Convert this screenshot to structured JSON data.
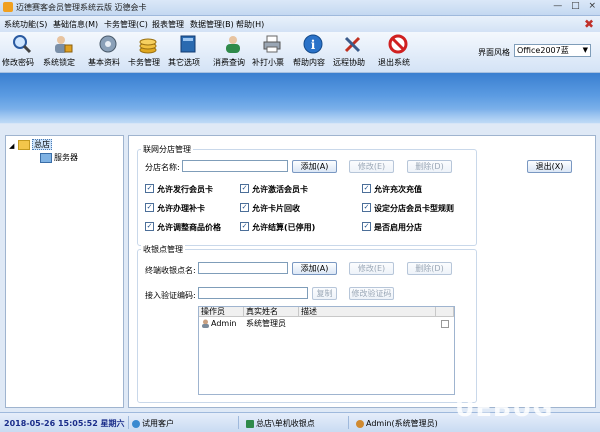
{
  "window": {
    "title": "迈德赛客会员管理系统云版  迈德会卡",
    "controls": [
      "—",
      "□",
      "×"
    ]
  },
  "menu": {
    "items": [
      "系统功能(S)",
      "基础信息(M)",
      "卡务管理(C)",
      "报表管理",
      "数据管理(B)",
      "帮助(H)"
    ],
    "close_glyph": "✖"
  },
  "toolbar": {
    "buttons": [
      {
        "label": "修改密码",
        "icon": "magnifier-icon"
      },
      {
        "label": "系统锁定",
        "icon": "lock-user-icon"
      },
      {
        "label": "基本资料",
        "icon": "gear-icon"
      },
      {
        "label": "卡务管理",
        "icon": "coins-icon"
      },
      {
        "label": "其它选项",
        "icon": "book-icon"
      },
      {
        "label": "消费查询",
        "icon": "user-icon"
      },
      {
        "label": "补打小票",
        "icon": "printer-icon"
      },
      {
        "label": "帮助内容",
        "icon": "info-icon"
      },
      {
        "label": "远程协助",
        "icon": "tools-icon"
      },
      {
        "label": "退出系统",
        "icon": "stop-icon"
      }
    ],
    "theme_label": "界面风格",
    "theme_value": "Office2007蓝"
  },
  "tree": {
    "root": "总店",
    "child": "服务器"
  },
  "branch": {
    "group_title": "联网分店管理",
    "name_label": "分店名称:",
    "name_value": "",
    "add": "添加(A)",
    "edit": "修改(E)",
    "delete": "删除(D)",
    "exit": "退出(X)",
    "options": [
      {
        "label": "允许发行会员卡",
        "checked": true
      },
      {
        "label": "允许激活会员卡",
        "checked": true
      },
      {
        "label": "允许充次充值",
        "checked": true
      },
      {
        "label": "允许办理补卡",
        "checked": true
      },
      {
        "label": "允许卡片回收",
        "checked": true
      },
      {
        "label": "设定分店会员卡型规则",
        "checked": true
      },
      {
        "label": "允许调整商品价格",
        "checked": true
      },
      {
        "label": "允许结算(已停用)",
        "checked": true
      },
      {
        "label": "是否启用分店",
        "checked": true
      }
    ]
  },
  "terminal": {
    "group_title": "收银点管理",
    "name_label": "终端收银点名:",
    "name_value": "",
    "add": "添加(A)",
    "edit": "修改(E)",
    "delete": "删除(D)",
    "code_label": "接入验证编码:",
    "code_value": "",
    "copy": "复制",
    "change_code": "修改验证码",
    "columns": [
      "操作员",
      "真实姓名",
      "描述"
    ],
    "rows": [
      {
        "operator": "Admin",
        "real_name": "系统管理员",
        "desc": ""
      }
    ]
  },
  "status": {
    "datetime": "2018-05-26 15:05:52 星期六",
    "customer": "试用客户",
    "location": "总店\\单机收银点",
    "user": "Admin(系统管理员)",
    "watermark": "UEBUG"
  }
}
